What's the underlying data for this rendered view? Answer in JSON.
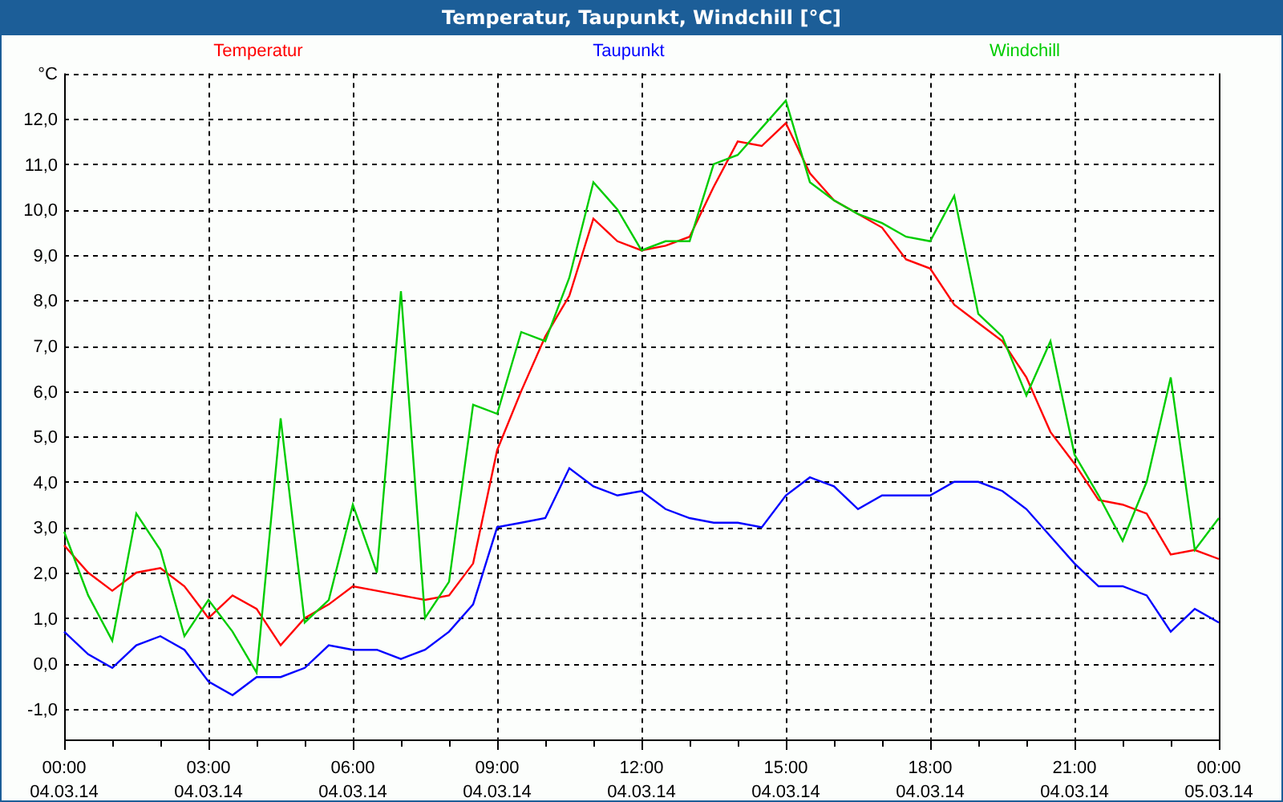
{
  "window": {
    "title": "Temperatur, Taupunkt, Windchill [°C]"
  },
  "chart": {
    "chart_data": {
      "type": "line",
      "categories": [
        "00:00\n04.03.14",
        null,
        null,
        null,
        null,
        null,
        "03:00\n04.03.14",
        null,
        null,
        null,
        null,
        null,
        "06:00\n04.03.14",
        null,
        null,
        null,
        null,
        null,
        "09:00\n04.03.14",
        null,
        null,
        null,
        null,
        null,
        "12:00\n04.03.14",
        null,
        null,
        null,
        null,
        null,
        "15:00\n04.03.14",
        null,
        null,
        null,
        null,
        null,
        "18:00\n04.03.14",
        null,
        null,
        null,
        null,
        null,
        "21:00\n04.03.14",
        null,
        null,
        null,
        null,
        null,
        "00:00\n05.03.14"
      ],
      "ylim": [
        -1.67,
        13
      ],
      "grid": true,
      "yticks": [
        {
          "value": -1,
          "label": "-1,0"
        },
        {
          "value": 0,
          "label": "0,0"
        },
        {
          "value": 1,
          "label": "1,0"
        },
        {
          "value": 2,
          "label": "2,0"
        },
        {
          "value": 3,
          "label": "3,0"
        },
        {
          "value": 4,
          "label": "4,0"
        },
        {
          "value": 5,
          "label": "5,0"
        },
        {
          "value": 6,
          "label": "6,0"
        },
        {
          "value": 7,
          "label": "7,0"
        },
        {
          "value": 8,
          "label": "8,0"
        },
        {
          "value": 9,
          "label": "9,0"
        },
        {
          "value": 10,
          "label": "10,0"
        },
        {
          "value": 11,
          "label": "11,0"
        },
        {
          "value": 12,
          "label": "12,0"
        },
        {
          "value": 13,
          "label": "°C"
        }
      ],
      "series": [
        {
          "name": "Temperatur",
          "color": "#ff0000",
          "values": [
            2.6,
            2.0,
            1.6,
            2.0,
            2.1,
            1.7,
            1.0,
            1.5,
            1.2,
            0.4,
            1.0,
            1.3,
            1.7,
            1.6,
            1.5,
            1.4,
            1.5,
            2.2,
            4.7,
            6.0,
            7.2,
            8.1,
            9.8,
            9.3,
            9.1,
            9.2,
            9.4,
            10.5,
            11.5,
            11.4,
            11.9,
            10.8,
            10.2,
            9.9,
            9.6,
            8.9,
            8.7,
            7.9,
            7.5,
            7.1,
            6.3,
            5.1,
            4.4,
            3.6,
            3.5,
            3.3,
            2.4,
            2.5,
            2.3
          ]
        },
        {
          "name": "Taupunkt",
          "color": "#0000ff",
          "values": [
            0.7,
            0.2,
            -0.1,
            0.4,
            0.6,
            0.3,
            -0.4,
            -0.7,
            -0.3,
            -0.3,
            -0.1,
            0.4,
            0.3,
            0.3,
            0.1,
            0.3,
            0.7,
            1.3,
            3.0,
            3.1,
            3.2,
            4.3,
            3.9,
            3.7,
            3.8,
            3.4,
            3.2,
            3.1,
            3.1,
            3.0,
            3.7,
            4.1,
            3.9,
            3.4,
            3.7,
            3.7,
            3.7,
            4.0,
            4.0,
            3.8,
            3.4,
            2.8,
            2.2,
            1.7,
            1.7,
            1.5,
            0.7,
            1.2,
            0.9
          ]
        },
        {
          "name": "Windchill",
          "color": "#00cc00",
          "values": [
            2.9,
            1.5,
            0.5,
            3.3,
            2.5,
            0.6,
            1.4,
            0.7,
            -0.2,
            5.4,
            0.9,
            1.4,
            3.5,
            2.0,
            8.2,
            1.0,
            1.8,
            5.7,
            5.5,
            7.3,
            7.1,
            8.5,
            10.6,
            10.0,
            9.1,
            9.3,
            9.3,
            11.0,
            11.2,
            11.8,
            12.4,
            10.6,
            10.2,
            9.9,
            9.7,
            9.4,
            9.3,
            10.3,
            7.7,
            7.2,
            5.9,
            7.1,
            4.6,
            3.7,
            2.7,
            4.0,
            6.3,
            2.5,
            3.2
          ]
        }
      ]
    }
  }
}
